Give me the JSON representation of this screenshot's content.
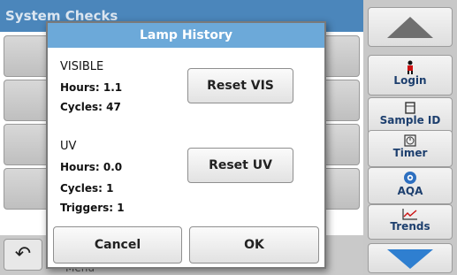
{
  "background": {
    "title": "System Checks",
    "partial_label": "Menu"
  },
  "sidebar": {
    "login": {
      "label": "Login",
      "icon": "person-icon"
    },
    "sample_id": {
      "label": "Sample ID",
      "icon": "sample-id-icon"
    },
    "timer": {
      "label": "Timer",
      "icon": "timer-icon"
    },
    "aqa": {
      "label": "AQA",
      "icon": "aqa-icon"
    },
    "trends": {
      "label": "Trends",
      "icon": "trends-icon"
    }
  },
  "dialog": {
    "title": "Lamp History",
    "visible": {
      "heading": "VISIBLE",
      "hours": "Hours: 1.1",
      "cycles": "Cycles: 47",
      "reset_label": "Reset VIS"
    },
    "uv": {
      "heading": "UV",
      "hours": "Hours: 0.0",
      "cycles": "Cycles: 1",
      "triggers": "Triggers: 1",
      "reset_label": "Reset UV"
    },
    "cancel_label": "Cancel",
    "ok_label": "OK"
  }
}
